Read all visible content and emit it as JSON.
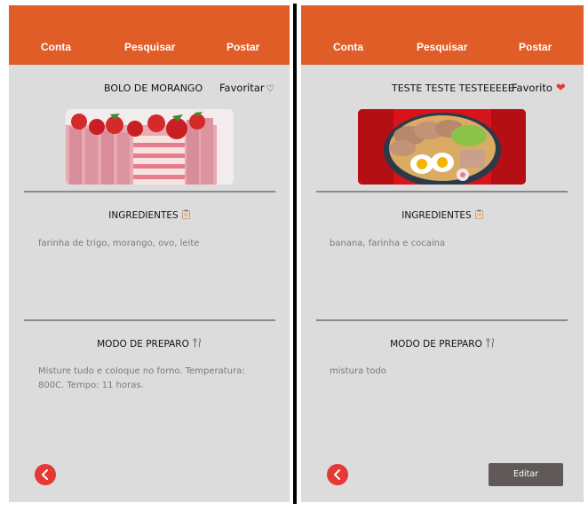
{
  "screens": [
    {
      "nav": {
        "account": "Conta",
        "search": "Pesquisar",
        "post": "Postar"
      },
      "recipe_title": "BOLO DE MORANGO",
      "favorite_label": "Favoritar",
      "favorite_icon": "heart-outline-icon",
      "ingredients_title": "INGREDIENTES",
      "ingredients_text": "farinha de trigo, morango, ovo, leite",
      "method_title": "MODO DE PREPARO",
      "method_text": "Misture tudo e coloque no forno. Temperatura: 800C. Tempo: 11 horas."
    },
    {
      "nav": {
        "account": "Conta",
        "search": "Pesquisar",
        "post": "Postar"
      },
      "recipe_title": "TESTE TESTE TESTEEEEE",
      "favorite_label": "Favorito",
      "favorite_icon": "heart-filled-icon",
      "ingredients_title": "INGREDIENTES",
      "ingredients_text": "banana, farinha e cocaina",
      "method_title": "MODO DE PREPARO",
      "method_text": "mistura todo",
      "edit_label": "Editar"
    }
  ],
  "colors": {
    "header": "#e05d27",
    "back_button": "#e53935",
    "edit_button": "#5f5a57",
    "panel": "#dcdcdc"
  }
}
